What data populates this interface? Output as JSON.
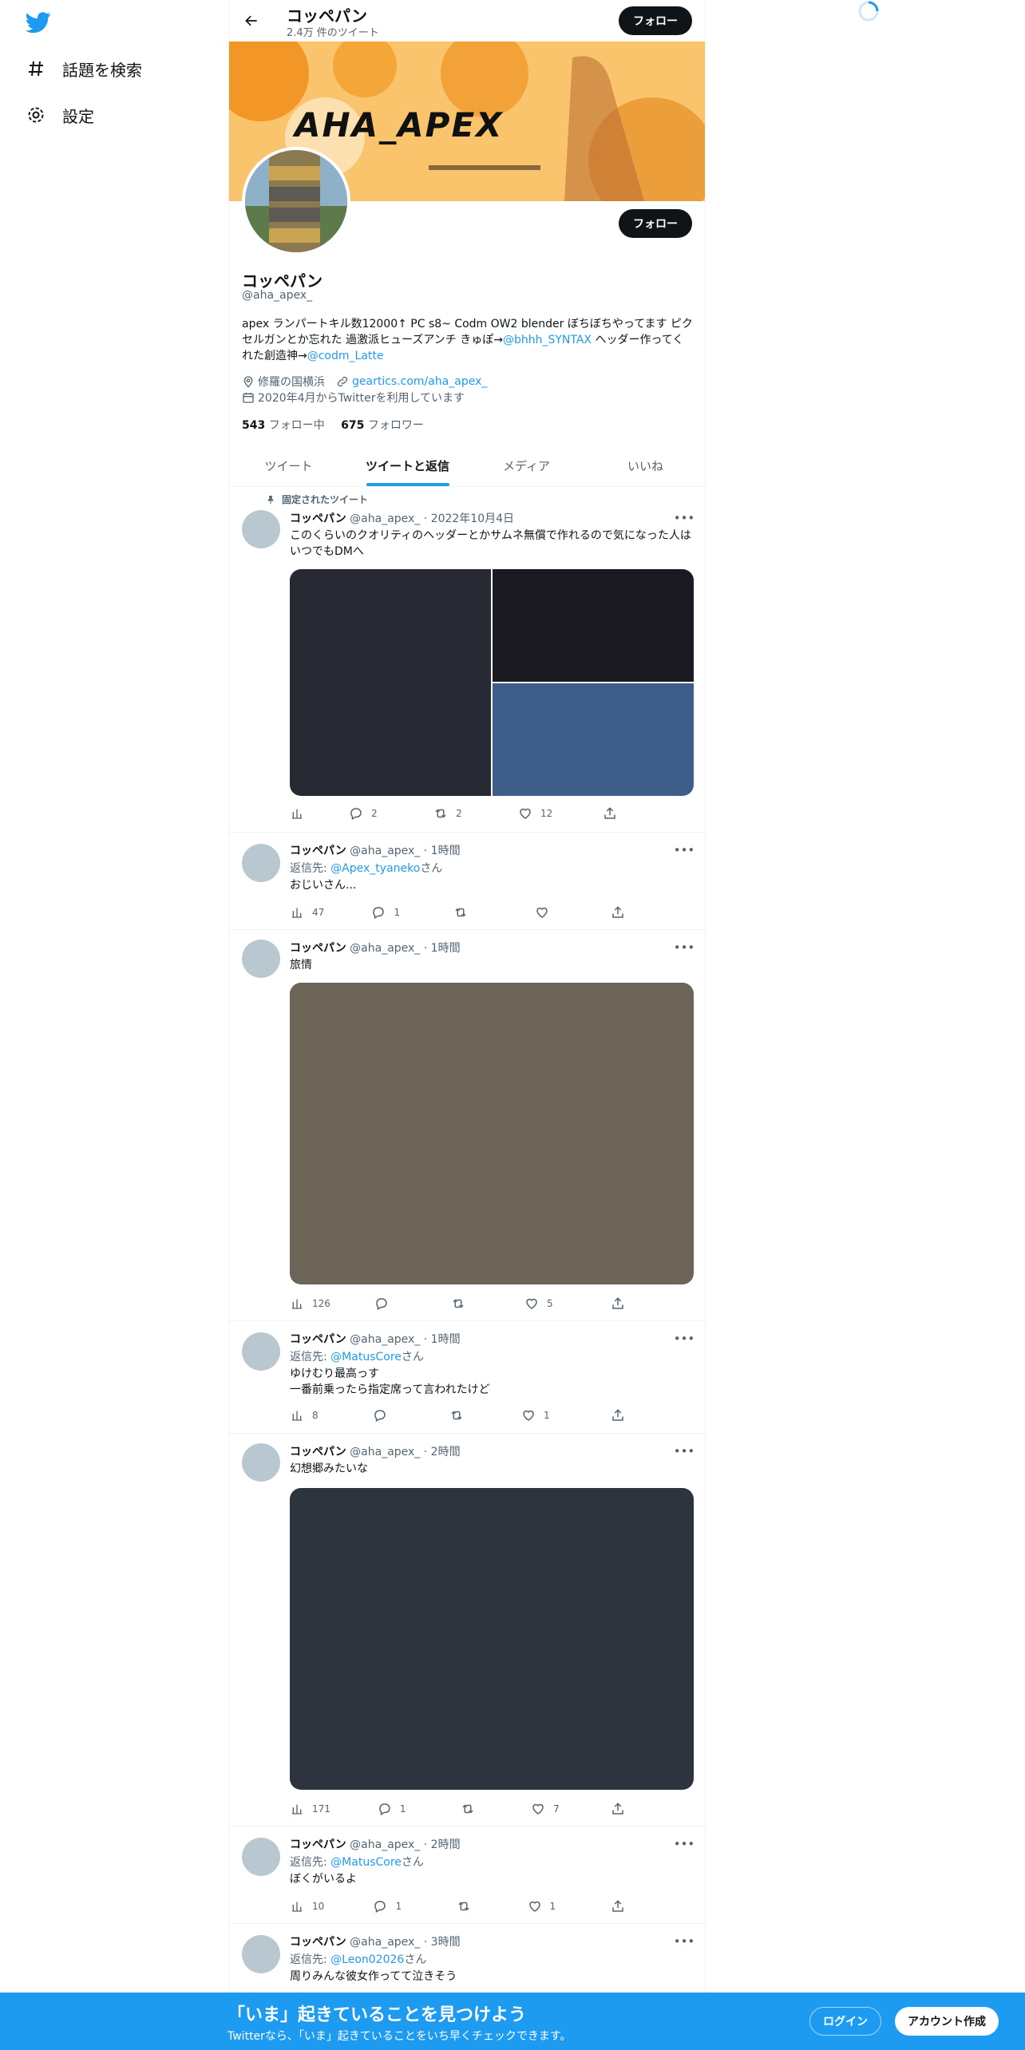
{
  "nav": {
    "explore_label": "話題を検索",
    "settings_label": "設定"
  },
  "profile": {
    "name": "コッペパン",
    "tweet_count": "2.4万 件のツイート",
    "follow_label": "フォロー",
    "handle": "@aha_apex_",
    "banner_text": "AHA_APEX",
    "bio_text": "apex ランパートキル数12000↑ PC s8~ Codm OW2 blender ぼちぼちやってます ピクセルガンとか忘れた 過激派ヒューズアンチ きゅぽ→",
    "bio_link1": "@bhhh_SYNTAX",
    "bio_mid": " ヘッダー作ってくれた創造神→",
    "bio_link2": "@codm_Latte",
    "location": "修羅の国横浜",
    "website": "geartics.com/aha_apex_",
    "joined": "2020年4月からTwitterを利用しています",
    "following_count": "543",
    "following_label": "フォロー中",
    "followers_count": "675",
    "followers_label": "フォロワー"
  },
  "tabs": [
    "ツイート",
    "ツイートと返信",
    "メディア",
    "いいね"
  ],
  "tweets": [
    {
      "pinned_label": "固定されたツイート",
      "name": "コッペパン",
      "handle_time": "@aha_apex_ · 2022年10月4日",
      "text": "このくらいのクオリティのヘッダーとかサムネ無償で作れるので気になった人はいつでもDMへ",
      "views": "",
      "replies": "2",
      "retweets": "2",
      "likes": "12"
    },
    {
      "name": "コッペパン",
      "handle_time": "@aha_apex_ · 1時間",
      "reply_prefix": "返信先: ",
      "reply_to": "@Apex_tyaneko",
      "reply_suffix": "さん",
      "text": "おじいさん...",
      "views": "47",
      "replies": "1",
      "retweets": "",
      "likes": ""
    },
    {
      "name": "コッペパン",
      "handle_time": "@aha_apex_ · 1時間",
      "text": "旅情",
      "views": "126",
      "replies": "",
      "retweets": "",
      "likes": "5"
    },
    {
      "name": "コッペパン",
      "handle_time": "@aha_apex_ · 1時間",
      "reply_prefix": "返信先: ",
      "reply_to": "@MatusCore",
      "reply_suffix": "さん",
      "text_line1": "ゆけむり最高っす",
      "text_line2": "一番前乗ったら指定席って言われたけど",
      "views": "8",
      "replies": "",
      "retweets": "",
      "likes": "1"
    },
    {
      "name": "コッペパン",
      "handle_time": "@aha_apex_ · 2時間",
      "text": "幻想郷みたいな",
      "views": "171",
      "replies": "1",
      "retweets": "",
      "likes": "7"
    },
    {
      "name": "コッペパン",
      "handle_time": "@aha_apex_ · 2時間",
      "reply_prefix": "返信先: ",
      "reply_to": "@MatusCore",
      "reply_suffix": "さん",
      "text": "ぼくがいるよ",
      "views": "10",
      "replies": "1",
      "retweets": "",
      "likes": "1"
    },
    {
      "name": "コッペパン",
      "handle_time": "@aha_apex_ · 3時間",
      "reply_prefix": "返信先: ",
      "reply_to": "@Leon02026",
      "reply_suffix": "さん",
      "text": "周りみんな彼女作ってて泣きそう"
    }
  ],
  "bottom": {
    "title": "「いま」起きていることを見つけよう",
    "subtitle": "Twitterなら、「いま」起きていることをいち早くチェックできます。",
    "login_label": "ログイン",
    "signup_label": "アカウント作成"
  },
  "colors": {
    "accent": "#1d9bf0",
    "text": "#0f1419",
    "muted": "#536471",
    "banner_orange": "#f7a23c"
  }
}
